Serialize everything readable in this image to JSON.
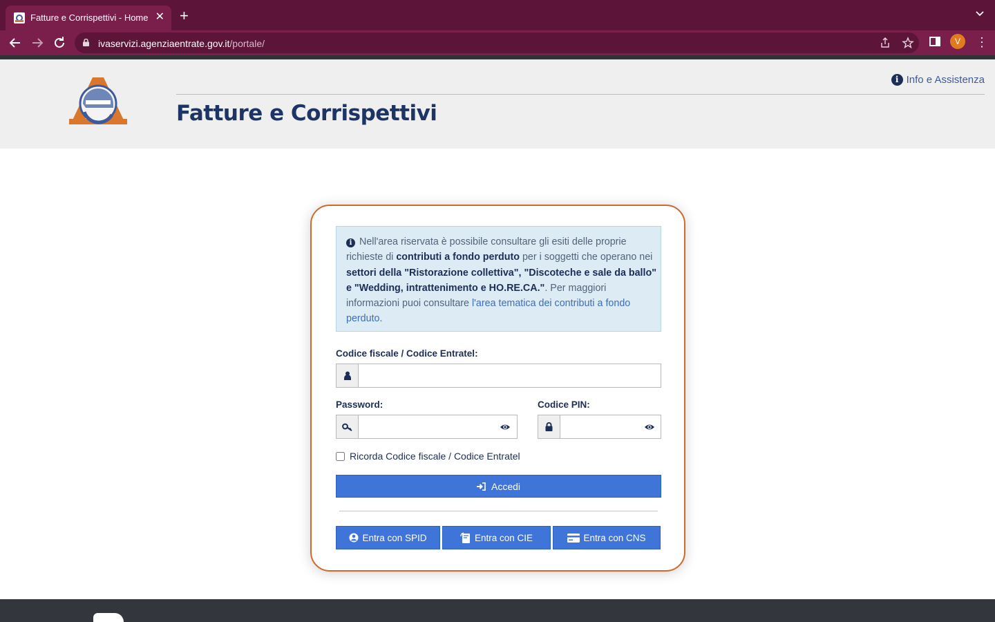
{
  "browser": {
    "tab_title": "Fatture e Corrispettivi - Home",
    "tab_close": "✕",
    "new_tab": "+",
    "url_host": "ivaservizi.agenziaentrate.gov.it",
    "url_path": "/portale/",
    "profile_initial": "V",
    "theme_color": "#7a1e4b",
    "icons": [
      "back-icon",
      "forward-icon",
      "reload-icon",
      "lock-icon",
      "share-icon",
      "star-icon",
      "side-panel-icon",
      "menu-icon"
    ]
  },
  "header": {
    "site_title": "Fatture e Corrispettivi",
    "info_label": "Info e Assistenza",
    "title_color": "#1c3566"
  },
  "notice": {
    "text_1": "Nell'area riservata è possibile consultare gli esiti delle proprie richieste di ",
    "bold_1": "contributi a fondo perduto",
    "text_2": " per i soggetti che operano nei ",
    "bold_2": "settori della \"Ristorazione collettiva\", \"Discoteche e sale da ballo\" e \"Wedding, intrattenimento e HO.RE.CA.\"",
    "text_3": ". Per maggiori informazioni puoi consultare ",
    "link": "l'area tematica dei contributi a fondo perduto",
    "text_4": "."
  },
  "form": {
    "cf_label": "Codice fiscale / Codice Entratel:",
    "cf_value": "",
    "password_label": "Password:",
    "password_value": "",
    "pin_label": "Codice PIN:",
    "pin_value": "",
    "remember_label": "Ricorda Codice fiscale / Codice Entratel",
    "remember_checked": false,
    "submit_label": "Accedi",
    "accent_color": "#3f74d8",
    "card_border_color": "#d0692c"
  },
  "alt_login": {
    "spid_label": "Entra con SPID",
    "cie_label": "Entra con CIE",
    "cns_label": "Entra con CNS"
  }
}
